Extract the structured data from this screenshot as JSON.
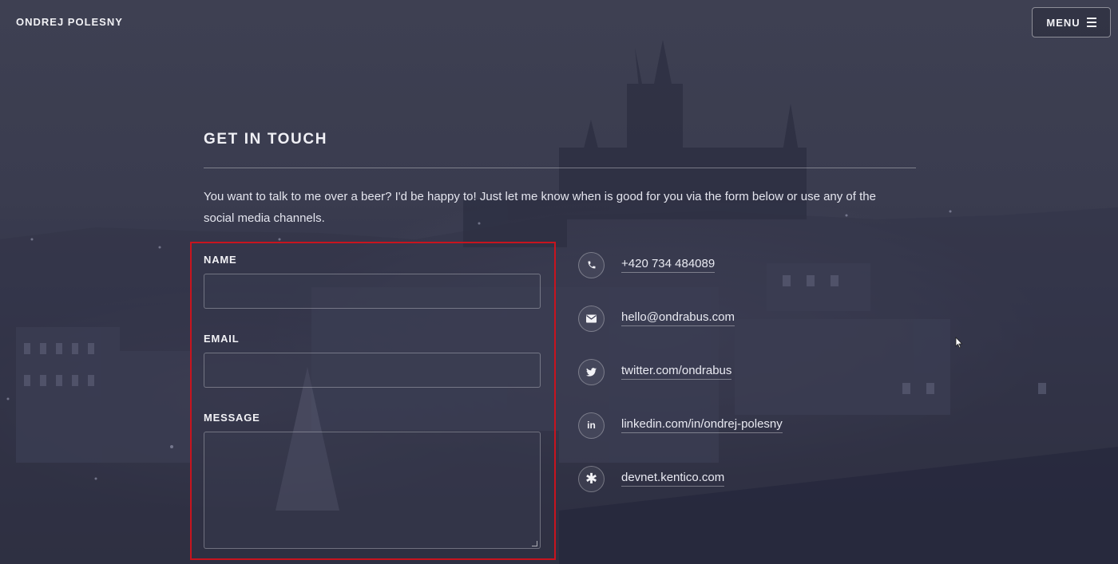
{
  "header": {
    "brand": "ONDREJ POLESNY",
    "menu_label": "MENU"
  },
  "section": {
    "title": "GET IN TOUCH",
    "intro": "You want to talk to me over a beer? I'd be happy to! Just let me know when is good for you via the form below or use any of the social media channels."
  },
  "form": {
    "name_label": "NAME",
    "name_value": "",
    "email_label": "EMAIL",
    "email_value": "",
    "message_label": "MESSAGE",
    "message_value": ""
  },
  "contacts": [
    {
      "icon": "phone-icon",
      "text": "+420 734 484089"
    },
    {
      "icon": "envelope-icon",
      "text": "hello@ondrabus.com"
    },
    {
      "icon": "twitter-icon",
      "text": "twitter.com/ondrabus"
    },
    {
      "icon": "linkedin-icon",
      "text": "linkedin.com/in/ondrej-polesny"
    },
    {
      "icon": "asterisk-icon",
      "text": "devnet.kentico.com"
    }
  ],
  "colors": {
    "highlight": "#c8141e",
    "background": "#2b2c3b"
  }
}
